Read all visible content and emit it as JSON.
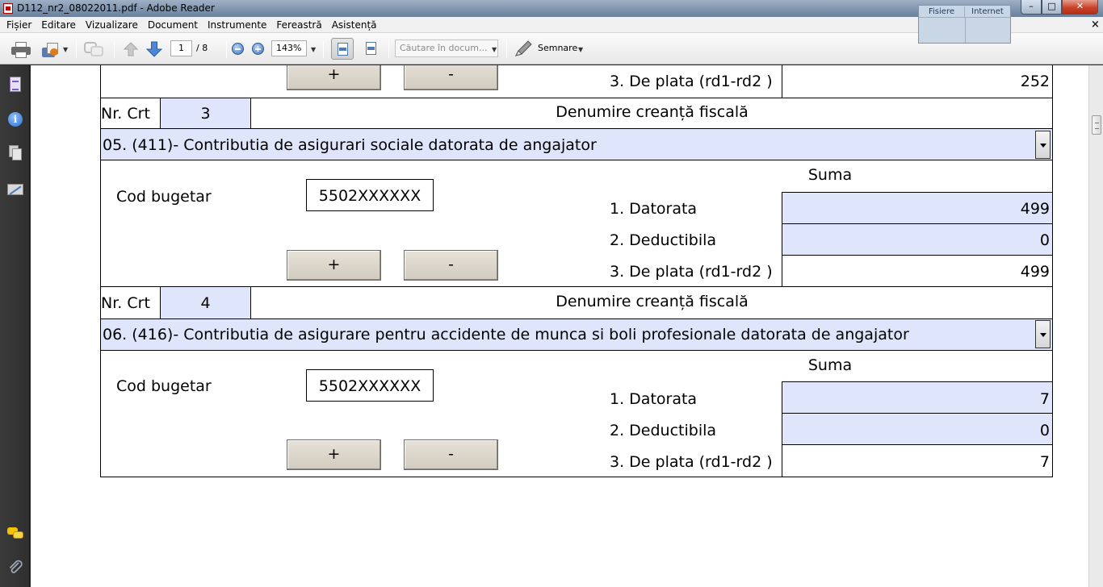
{
  "window": {
    "title": "D112_nr2_08022011.pdf - Adobe Reader",
    "tabs": [
      "Fisiere",
      "Internet"
    ],
    "buttons": {
      "minimize": "–",
      "maximize": "□",
      "close": "✕"
    },
    "doc_close": "×"
  },
  "menu": {
    "items": [
      "Fișier",
      "Editare",
      "Vizualizare",
      "Document",
      "Instrumente",
      "Fereastră",
      "Asistență"
    ]
  },
  "toolbar": {
    "page_current": "1",
    "page_total": "/ 8",
    "zoom": "143%",
    "search_placeholder": "Căutare în docum...",
    "sign_label": "Semnare"
  },
  "form": {
    "row_partial": {
      "plus": "+",
      "minus": "-",
      "de_plata_label": "3. De plata (rd1-rd2 )",
      "de_plata_value": "252"
    },
    "blocks": [
      {
        "nr_crt_label": "Nr. Crt",
        "nr_crt_value": "3",
        "denumire_label": "Denumire creanță fiscală",
        "claim": "05. (411)- Contributia de asigurari sociale datorata de angajator",
        "suma_label": "Suma",
        "cod_bugetar_label": "Cod bugetar",
        "cod_bugetar_value": "5502XXXXXX",
        "datorata_label": "1. Datorata",
        "datorata_value": "499",
        "deductibila_label": "2. Deductibila",
        "deductibila_value": "0",
        "de_plata_label": "3. De plata (rd1-rd2 )",
        "de_plata_value": "499",
        "plus": "+",
        "minus": "-"
      },
      {
        "nr_crt_label": "Nr. Crt",
        "nr_crt_value": "4",
        "denumire_label": "Denumire creanță fiscală",
        "claim": "06. (416)- Contributia de asigurare pentru accidente de munca si boli profesionale datorata de angajator",
        "suma_label": "Suma",
        "cod_bugetar_label": "Cod bugetar",
        "cod_bugetar_value": "5502XXXXXX",
        "datorata_label": "1. Datorata",
        "datorata_value": "7",
        "deductibila_label": "2. Deductibila",
        "deductibila_value": "0",
        "de_plata_label": "3. De plata (rd1-rd2 )",
        "de_plata_value": "7",
        "plus": "+",
        "minus": "-"
      }
    ]
  },
  "colors": {
    "field_blue": "#dfe5fb",
    "nav_bg": "#2f2f2f"
  }
}
